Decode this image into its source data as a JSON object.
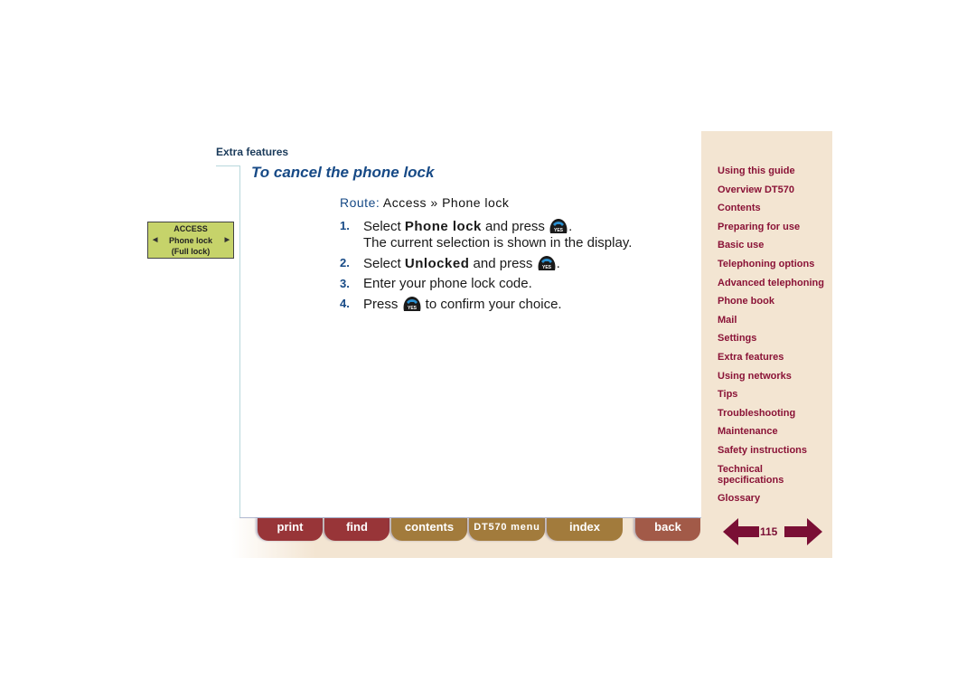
{
  "header": {
    "section": "Extra features",
    "title": "To cancel the phone lock"
  },
  "route": {
    "label": "Route:",
    "path": "Access » Phone lock"
  },
  "display": {
    "line1": "ACCESS",
    "line2": "Phone lock",
    "line3": "(Full lock)",
    "left_arrow_icon": "triangle-left",
    "right_arrow_icon": "triangle-right"
  },
  "steps": [
    {
      "num": "1.",
      "pre": "Select ",
      "kw": "Phone lock",
      "post": " and press",
      "icon": "yes-key-icon",
      "tail": ".",
      "line2": "The current selection is shown in the display."
    },
    {
      "num": "2.",
      "pre": "Select ",
      "kw": "Unlocked",
      "post": " and press",
      "icon": "yes-key-icon",
      "tail": "."
    },
    {
      "num": "3.",
      "text": "Enter your phone lock code."
    },
    {
      "num": "4.",
      "pre": "Press",
      "icon": "yes-key-icon",
      "post": " to confirm your choice."
    }
  ],
  "yes_key": {
    "label": "YES",
    "body_color": "#1a1a1a",
    "handset_color": "#2a8fd0"
  },
  "sidebar": {
    "items": [
      "Using this guide",
      "Overview DT570",
      "Contents",
      "Preparing for use",
      "Basic use",
      "Telephoning options",
      "Advanced telephoning",
      "Phone book",
      "Mail",
      "Settings",
      "Extra features",
      "Using networks",
      "Tips",
      "Troubleshooting",
      "Maintenance",
      "Safety instructions",
      "Technical specifications",
      "Glossary"
    ]
  },
  "nav_buttons": {
    "print": "print",
    "find": "find",
    "contents": "contents",
    "dt570_menu": "DT570 menu",
    "index": "index",
    "back": "back"
  },
  "pager": {
    "page": "115",
    "prev_icon": "arrow-left",
    "next_icon": "arrow-right",
    "color": "#7a0f35"
  }
}
